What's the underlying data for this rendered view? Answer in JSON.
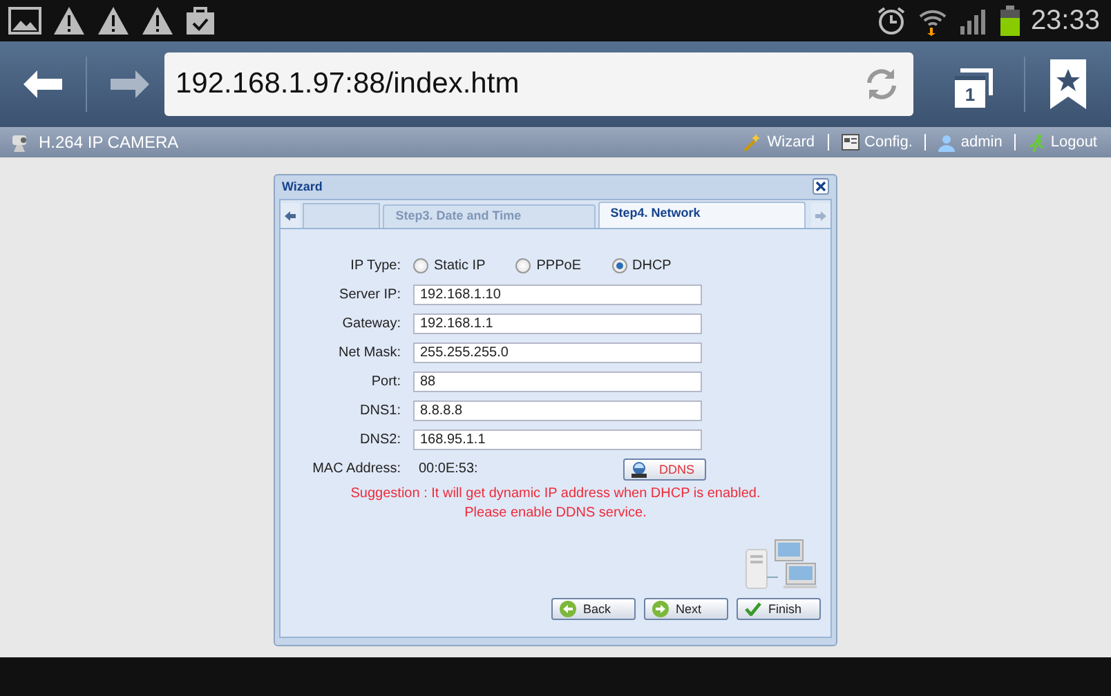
{
  "status_bar": {
    "time": "23:33"
  },
  "browser": {
    "url": "192.168.1.97:88/index.htm",
    "tab_count": "1"
  },
  "header": {
    "title": "H.264 IP CAMERA",
    "links": [
      {
        "label": "Wizard",
        "kind": "wizard"
      },
      {
        "label": "Config.",
        "kind": "config"
      },
      {
        "label": "admin",
        "kind": "user"
      },
      {
        "label": "Logout",
        "kind": "logout"
      }
    ]
  },
  "wizard": {
    "title": "Wizard",
    "tabs": [
      {
        "label": "Step3. Date and Time",
        "selected": false
      },
      {
        "label": "Step4. Network",
        "selected": true
      }
    ],
    "ip_type": {
      "label": "IP Type:",
      "options": [
        {
          "label": "Static IP",
          "selected": false
        },
        {
          "label": "PPPoE",
          "selected": false
        },
        {
          "label": "DHCP",
          "selected": true
        }
      ]
    },
    "fields": [
      {
        "label": "Server IP:",
        "value": "192.168.1.10"
      },
      {
        "label": "Gateway:",
        "value": "192.168.1.1"
      },
      {
        "label": "Net Mask:",
        "value": "255.255.255.0"
      },
      {
        "label": "Port:",
        "value": "88"
      },
      {
        "label": "DNS1:",
        "value": "8.8.8.8"
      },
      {
        "label": "DNS2:",
        "value": "168.95.1.1"
      }
    ],
    "mac": {
      "label": "MAC Address:",
      "value": "00:0E:53:"
    },
    "ddns_button": "DDNS",
    "suggestion": [
      "Suggestion : It will get dynamic IP address when DHCP is enabled.",
      "Please enable DDNS service."
    ],
    "buttons": [
      {
        "label": "Back",
        "kind": "back"
      },
      {
        "label": "Next",
        "kind": "next"
      },
      {
        "label": "Finish",
        "kind": "finish"
      }
    ]
  }
}
